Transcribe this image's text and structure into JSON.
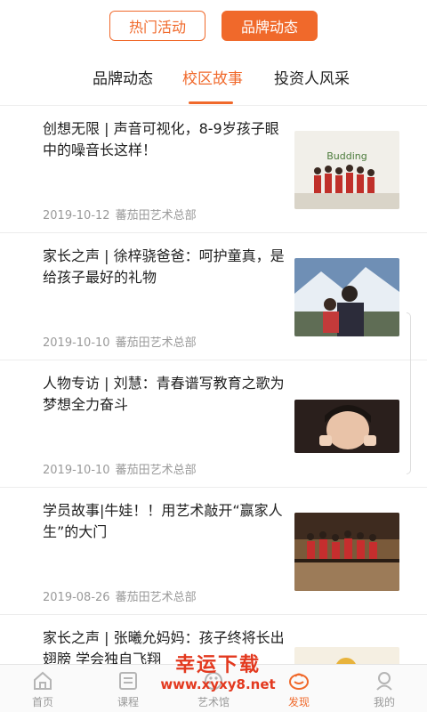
{
  "top_toggle": {
    "hot_label": "热门活动",
    "brand_label": "品牌动态",
    "active": "brand"
  },
  "subtabs": [
    {
      "label": "品牌动态"
    },
    {
      "label": "校区故事"
    },
    {
      "label": "投资人风采"
    }
  ],
  "active_subtab": "校区故事",
  "articles": [
    {
      "title": "创想无限 | 声音可视化，8-9岁孩子眼中的噪音长这样！",
      "date": "2019-10-12",
      "source": "蕃茄田艺术总部",
      "thumb_caption": "Budding"
    },
    {
      "title": "家长之声 | 徐梓骁爸爸：呵护童真，是给孩子最好的礼物",
      "date": "2019-10-10",
      "source": "蕃茄田艺术总部"
    },
    {
      "title": "人物专访 | 刘慧：青春谱写教育之歌为梦想全力奋斗",
      "date": "2019-10-10",
      "source": "蕃茄田艺术总部"
    },
    {
      "title": "学员故事|牛娃！！用艺术敲开“赢家人生”的大门",
      "date": "2019-08-26",
      "source": "蕃茄田艺术总部"
    },
    {
      "title": "家长之声 | 张曦允妈妈：孩子终将长出翅膀 学会独自飞翔",
      "date": "",
      "source": ""
    }
  ],
  "bottom_nav": [
    {
      "label": "首页",
      "icon": "home-icon"
    },
    {
      "label": "课程",
      "icon": "course-icon"
    },
    {
      "label": "艺术馆",
      "icon": "gallery-icon"
    },
    {
      "label": "发现",
      "icon": "discover-icon"
    },
    {
      "label": "我的",
      "icon": "profile-icon"
    }
  ],
  "active_nav": "发现",
  "watermark": {
    "title": "幸运下载",
    "url": "www.xyxy8.net"
  },
  "colors": {
    "accent": "#f0692b",
    "watermark": "#e3391f"
  }
}
